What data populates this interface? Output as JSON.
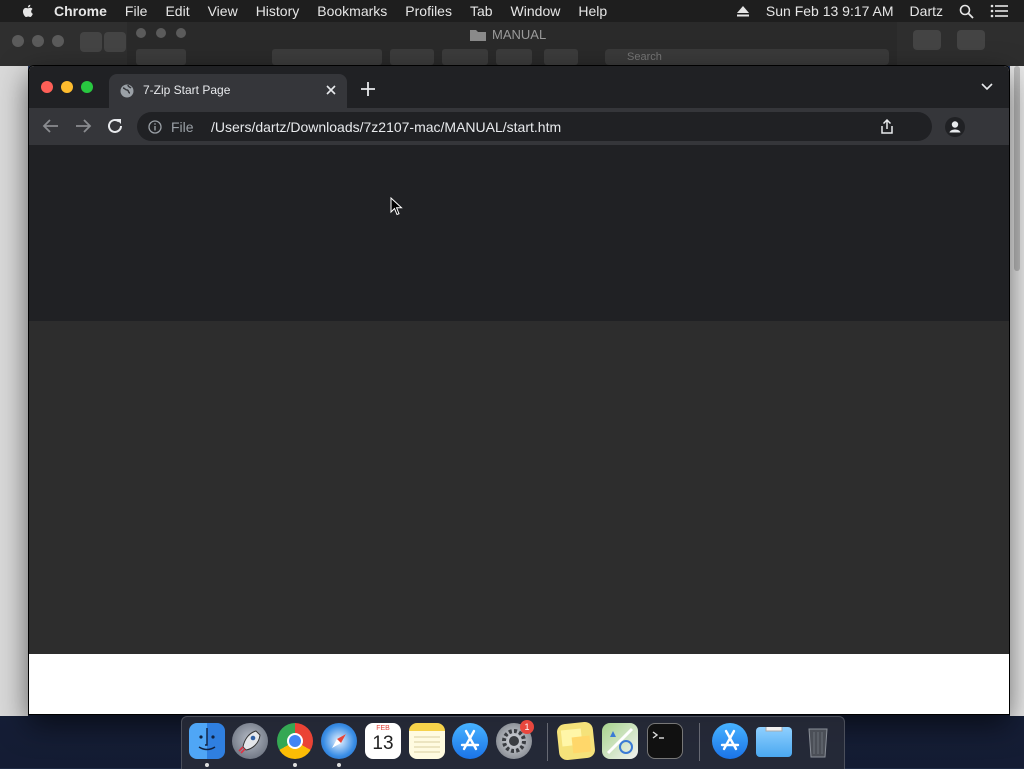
{
  "menubar": {
    "app_name": "Chrome",
    "items": [
      "File",
      "Edit",
      "View",
      "History",
      "Bookmarks",
      "Profiles",
      "Tab",
      "Window",
      "Help"
    ],
    "datetime": "Sun Feb 13  9:17 AM",
    "user": "Dartz"
  },
  "finder": {
    "title": "MANUAL",
    "search_placeholder": "Search"
  },
  "browser": {
    "tab_title": "7-Zip Start Page",
    "scheme_label": "File",
    "url": "/Users/dartz/Downloads/7z2107-mac/MANUAL/start.htm"
  },
  "dock": {
    "calendar_month": "FEB",
    "calendar_day": "13",
    "settings_badge": "1"
  },
  "colors": {
    "tabstrip": "#202124",
    "toolbar": "#35363a",
    "page_dark": "#202124",
    "page_mid": "#2d2d2d"
  }
}
